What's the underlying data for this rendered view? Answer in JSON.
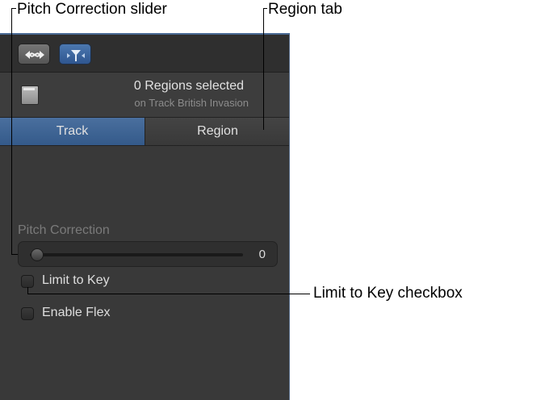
{
  "callouts": {
    "pitch_slider": "Pitch Correction slider",
    "region_tab": "Region tab",
    "limit_checkbox": "Limit to Key checkbox"
  },
  "header": {
    "title": "0 Regions selected",
    "subtitle": "on Track British Invasion"
  },
  "tabs": [
    {
      "label": "Track",
      "selected": true
    },
    {
      "label": "Region",
      "selected": false
    }
  ],
  "pitch_correction": {
    "label": "Pitch Correction",
    "value": "0",
    "fraction": 0
  },
  "checkboxes": {
    "limit_to_key": {
      "label": "Limit to Key",
      "checked": false
    },
    "enable_flex": {
      "label": "Enable Flex",
      "checked": false
    }
  },
  "toolbar": {
    "link_icon": "link-icon",
    "flex_icon": "flex-icon"
  },
  "colors": {
    "accent": "#3b6395",
    "panel_bg": "#393939"
  }
}
